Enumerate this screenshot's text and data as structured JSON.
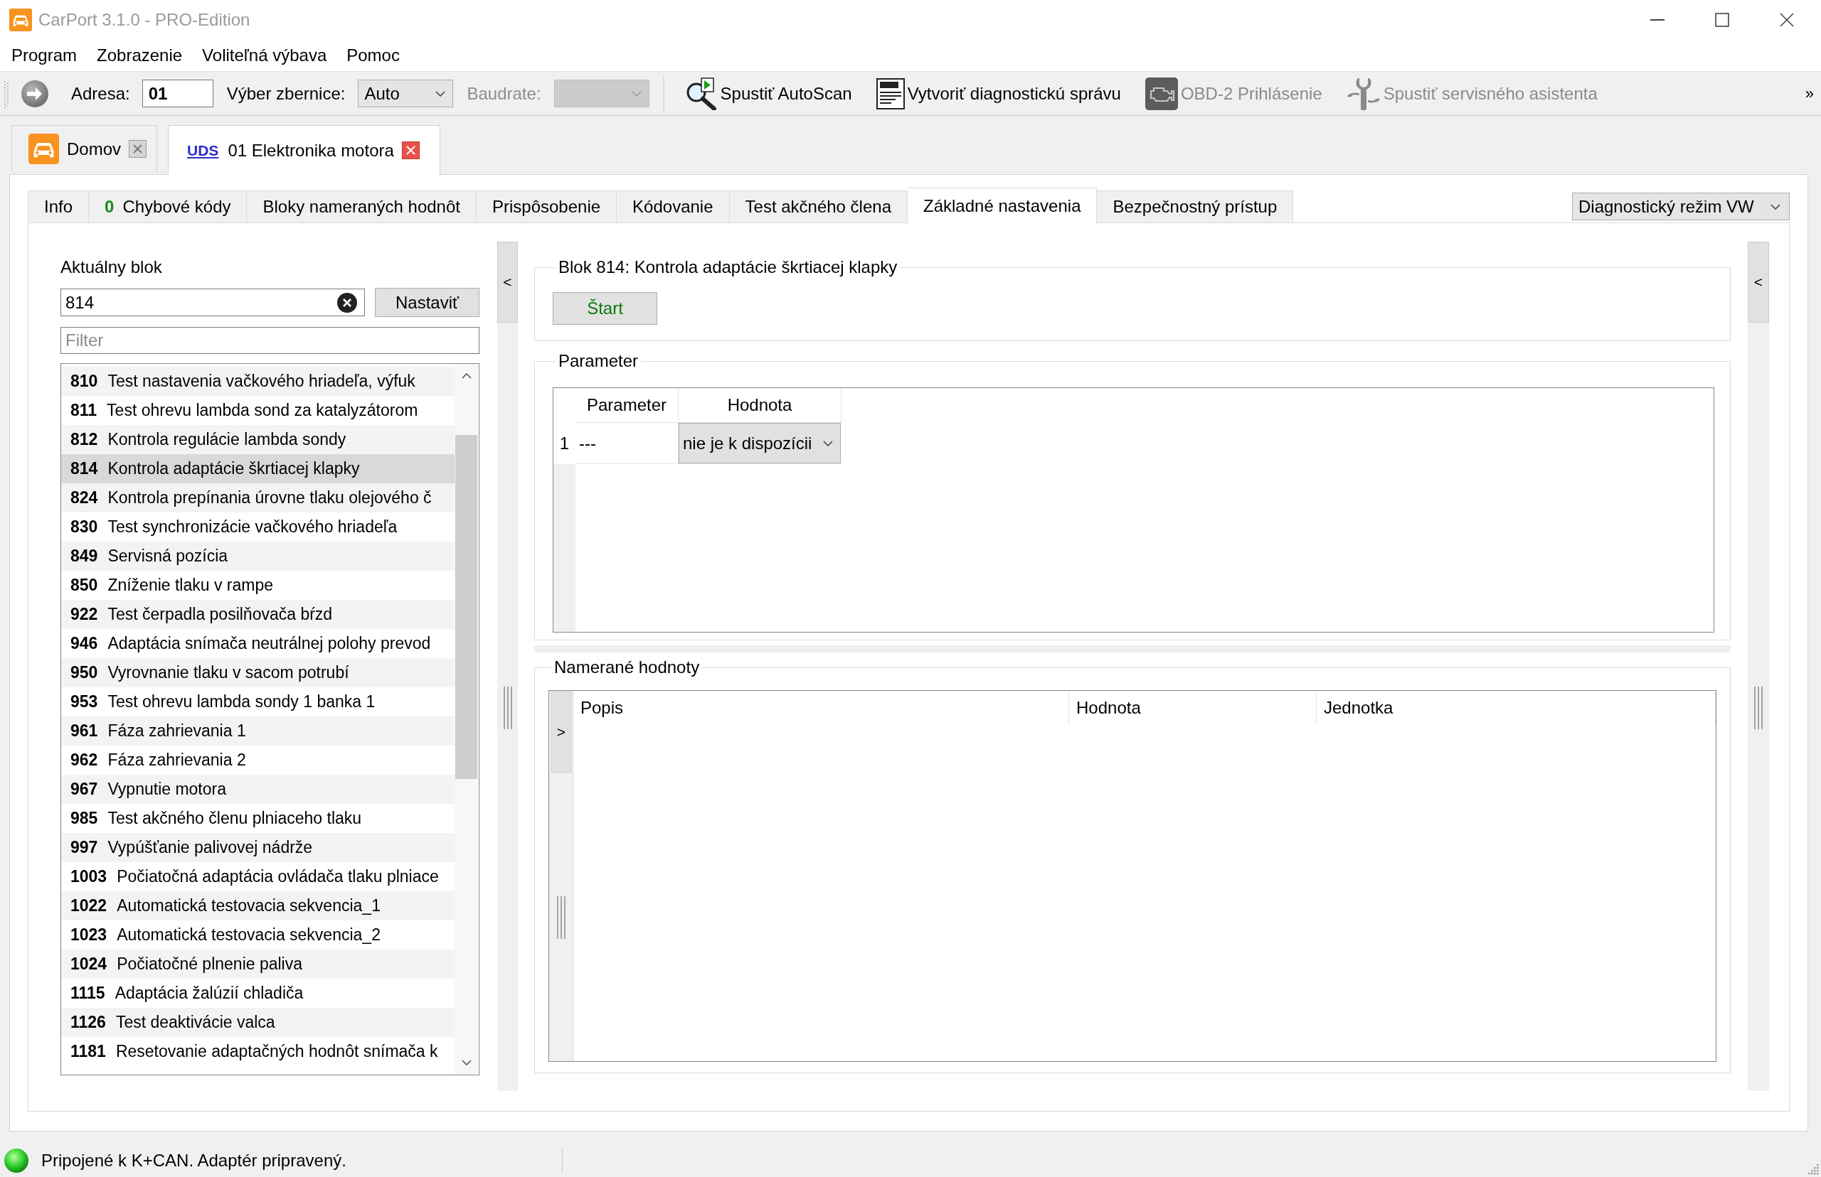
{
  "window": {
    "title": "CarPort 3.1.0 - PRO-Edition"
  },
  "menu": [
    "Program",
    "Zobrazenie",
    "Voliteľná výbava",
    "Pomoc"
  ],
  "toolbar": {
    "address_label": "Adresa:",
    "address": {
      "value": "01"
    },
    "bus_label": "Výber zbernice:",
    "bus_select": {
      "value": "Auto"
    },
    "baud_label": "Baudrate:",
    "baud_select": {
      "disabled": true
    },
    "actions": [
      {
        "label": "Spustiť AutoScan",
        "disabled": false
      },
      {
        "label": "Vytvoriť diagnostickú správu",
        "disabled": false
      },
      {
        "label": "OBD-2 Prihlásenie",
        "disabled": true
      },
      {
        "label": "Spustiť servisného asistenta",
        "disabled": true
      }
    ],
    "overflow": "»"
  },
  "document_tabs": [
    {
      "kind": "home",
      "label": "Domov",
      "selected": false
    },
    {
      "kind": "module",
      "badge": "UDS",
      "label": "01 Elektronika motora",
      "selected": true
    }
  ],
  "page_tabs": [
    {
      "label": "Info",
      "selected": false
    },
    {
      "count": "0",
      "label": "Chybové kódy",
      "selected": false
    },
    {
      "label": "Bloky nameraných hodnôt",
      "selected": false
    },
    {
      "label": "Prispôsobenie",
      "selected": false
    },
    {
      "label": "Kódovanie",
      "selected": false
    },
    {
      "label": "Test akčného člena",
      "selected": false
    },
    {
      "label": "Základné nastavenia",
      "selected": true
    },
    {
      "label": "Bezpečnostný prístup",
      "selected": false
    }
  ],
  "mode_select": {
    "value": "Diagnostický režim VW"
  },
  "block_panel": {
    "label": "Aktuálny blok",
    "block_input": {
      "value": "814"
    },
    "set_button": "Nastaviť",
    "filter": {
      "placeholder": "Filter"
    },
    "blocks": [
      {
        "number": "810",
        "name": "Test nastavenia vačkového hriadeľa, výfuk",
        "selected": false
      },
      {
        "number": "811",
        "name": "Test ohrevu lambda sond za katalyzátorom",
        "selected": false
      },
      {
        "number": "812",
        "name": "Kontrola regulácie lambda sondy",
        "selected": false
      },
      {
        "number": "814",
        "name": "Kontrola adaptácie škrtiacej klapky",
        "selected": true
      },
      {
        "number": "824",
        "name": "Kontrola prepínania úrovne tlaku olejového č",
        "selected": false
      },
      {
        "number": "830",
        "name": "Test synchronizácie vačkového hriadeľa",
        "selected": false
      },
      {
        "number": "849",
        "name": "Servisná pozícia",
        "selected": false
      },
      {
        "number": "850",
        "name": "Zníženie tlaku v rampe",
        "selected": false
      },
      {
        "number": "922",
        "name": "Test čerpadla posilňovača bŕzd",
        "selected": false
      },
      {
        "number": "946",
        "name": "Adaptácia snímača neutrálnej polohy prevod",
        "selected": false
      },
      {
        "number": "950",
        "name": "Vyrovnanie tlaku v sacom potrubí",
        "selected": false
      },
      {
        "number": "953",
        "name": "Test ohrevu lambda sondy 1 banka 1",
        "selected": false
      },
      {
        "number": "961",
        "name": "Fáza zahrievania 1",
        "selected": false
      },
      {
        "number": "962",
        "name": "Fáza zahrievania 2",
        "selected": false
      },
      {
        "number": "967",
        "name": "Vypnutie motora",
        "selected": false
      },
      {
        "number": "985",
        "name": "Test akčného členu plniaceho tlaku",
        "selected": false
      },
      {
        "number": "997",
        "name": "Vypúšťanie palivovej nádrže",
        "selected": false
      },
      {
        "number": "1003",
        "name": "Počiatočná adaptácia ovládača tlaku plniace",
        "selected": false
      },
      {
        "number": "1022",
        "name": "Automatická testovacia sekvencia_1",
        "selected": false
      },
      {
        "number": "1023",
        "name": "Automatická testovacia sekvencia_2",
        "selected": false
      },
      {
        "number": "1024",
        "name": "Počiatočné plnenie paliva",
        "selected": false
      },
      {
        "number": "1115",
        "name": "Adaptácia žalúzií chladiča",
        "selected": false
      },
      {
        "number": "1126",
        "name": "Test deaktivácie valca",
        "selected": false
      },
      {
        "number": "1181",
        "name": "Resetovanie adaptačných hodnôt snímača k",
        "selected": false
      }
    ]
  },
  "left_splitter": {
    "toggle": "<"
  },
  "block_group": {
    "title": "Blok 814: Kontrola adaptácie škrtiacej klapky",
    "start_button": "Štart"
  },
  "parameter_group": {
    "title": "Parameter",
    "columns": [
      "Parameter",
      "Hodnota"
    ],
    "rows": [
      {
        "row_header": "1",
        "parameter": "---",
        "value": "nie je k dispozícii"
      }
    ]
  },
  "measured_group": {
    "title": "Namerané hodnoty",
    "toggle": ">",
    "columns": [
      "Popis",
      "Hodnota",
      "Jednotka"
    ]
  },
  "right_splitter": {
    "toggle": "<"
  },
  "status_bar": {
    "connected": true,
    "text": "Pripojené k K+CAN. Adaptér pripravený."
  }
}
